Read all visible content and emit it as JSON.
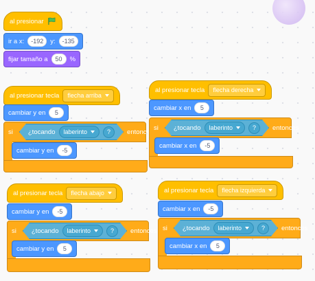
{
  "colors": {
    "events": "#ffbf00",
    "control": "#ffab19",
    "motion": "#4c97ff",
    "looks": "#9966ff",
    "sensing": "#5cb1d6",
    "flag_green": "#4cbf56"
  },
  "sprite": {
    "icon": "baseball-icon"
  },
  "script1": {
    "when_flag": "al presionar",
    "go_to_prefix": "ir a x:",
    "x": "-192",
    "y_label": "y:",
    "y": "-135",
    "size_label": "fijar tamaño a",
    "size_value": "50",
    "size_unit": "%"
  },
  "script_up": {
    "hat_label": "al presionar tecla",
    "key": "flecha arriba",
    "change_label": "cambiar y en",
    "change_value": "5",
    "if_label": "si",
    "touching_label": "¿tocando",
    "touching_target": "laberinto",
    "question": "?",
    "then_label": "entonces",
    "inner_label": "cambiar y en",
    "inner_value": "-5"
  },
  "script_right": {
    "hat_label": "al presionar tecla",
    "key": "flecha derecha",
    "change_label": "cambiar x en",
    "change_value": "5",
    "if_label": "si",
    "touching_label": "¿tocando",
    "touching_target": "laberinto",
    "question": "?",
    "then_label": "entonces",
    "inner_label": "cambiar x en",
    "inner_value": "-5"
  },
  "script_down": {
    "hat_label": "al presionar tecla",
    "key": "flecha abajo",
    "change_label": "cambiar y en",
    "change_value": "-5",
    "if_label": "si",
    "touching_label": "¿tocando",
    "touching_target": "laberinto",
    "question": "?",
    "then_label": "entonces",
    "inner_label": "cambiar y en",
    "inner_value": "5"
  },
  "script_left": {
    "hat_label": "al presionar tecla",
    "key": "flecha izquierda",
    "change_label": "cambiar x en",
    "change_value": "-5",
    "if_label": "si",
    "touching_label": "¿tocando",
    "touching_target": "laberinto",
    "question": "?",
    "then_label": "entonces",
    "inner_label": "cambiar x en",
    "inner_value": "5"
  }
}
